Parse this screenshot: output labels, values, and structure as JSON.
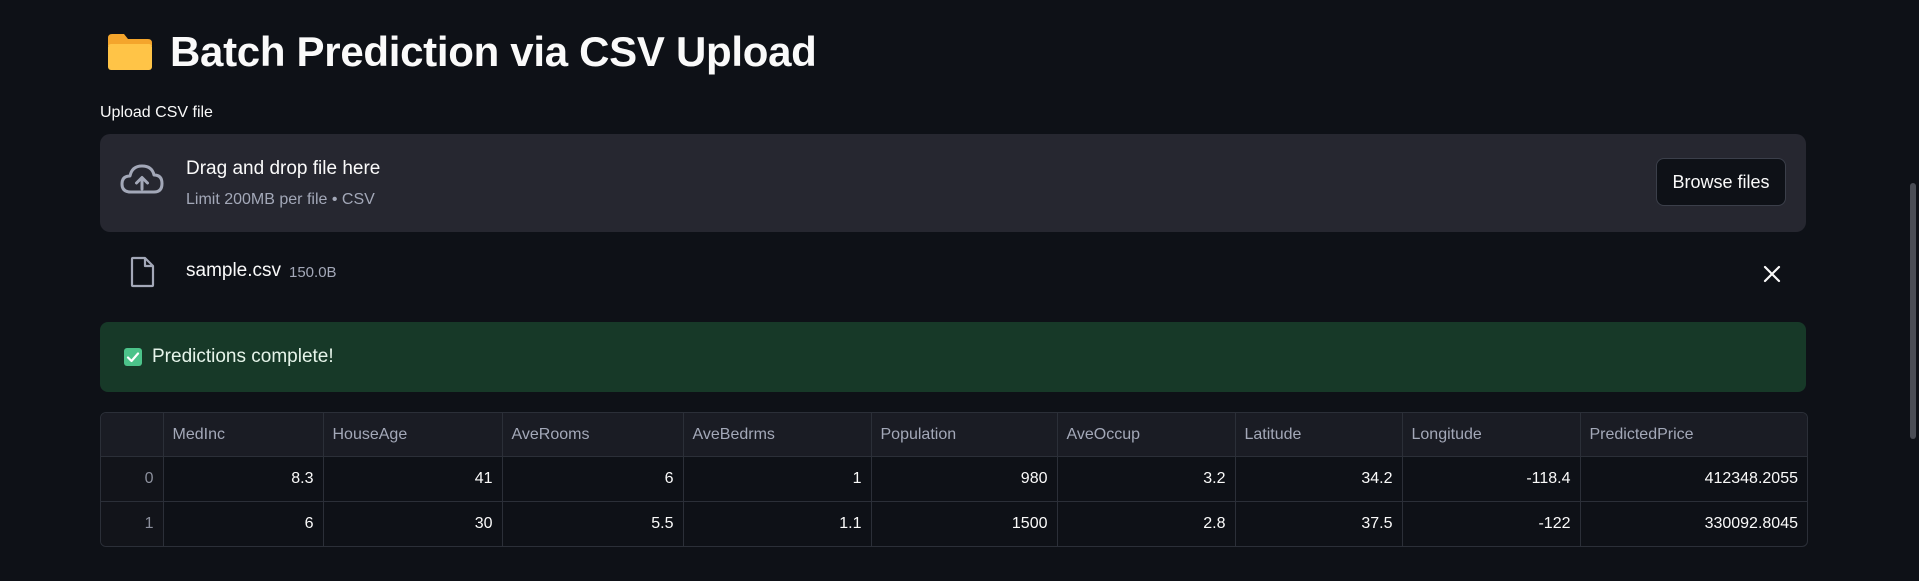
{
  "header": {
    "icon": "folder-icon",
    "title": "Batch Prediction via CSV Upload"
  },
  "uploader": {
    "label": "Upload CSV file",
    "drop_title": "Drag and drop file here",
    "drop_limit": "Limit 200MB per file • CSV",
    "browse_label": "Browse files",
    "icon": "cloud-upload-icon"
  },
  "uploaded_file": {
    "name": "sample.csv",
    "size": "150.0B",
    "icon": "file-icon",
    "remove_icon": "close-icon"
  },
  "alert": {
    "text": "Predictions complete!",
    "icon": "check-box-icon",
    "color": "#173928"
  },
  "table": {
    "columns": [
      "",
      "MedInc",
      "HouseAge",
      "AveRooms",
      "AveBedrms",
      "Population",
      "AveOccup",
      "Latitude",
      "Longitude",
      "PredictedPrice"
    ],
    "rows": [
      [
        "0",
        "8.3",
        "41",
        "6",
        "1",
        "980",
        "3.2",
        "34.2",
        "-118.4",
        "412348.2055"
      ],
      [
        "1",
        "6",
        "30",
        "5.5",
        "1.1",
        "1500",
        "2.8",
        "37.5",
        "-122",
        "330092.8045"
      ]
    ]
  },
  "colors": {
    "background": "#0e1117",
    "dropzone": "#262730",
    "success": "#173928"
  }
}
